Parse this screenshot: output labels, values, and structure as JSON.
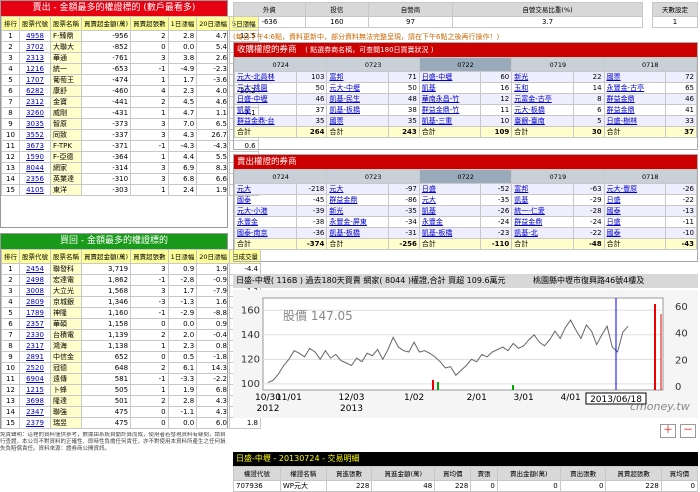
{
  "sell_panel": {
    "title": "賣出 - 金額最多的權證標的 (數戶最看多)",
    "cols": [
      "排行",
      "股票代號",
      "股票名稱",
      "買賣超金額(萬)",
      "買賣超張數",
      "1日漲幅",
      "20日漲幅",
      "5日漲幅"
    ],
    "rows": [
      [
        "1",
        "4958",
        "F-臻鼎",
        "-956",
        "2",
        "2.8",
        "4.7",
        "12.5"
      ],
      [
        "2",
        "3702",
        "大聯大",
        "-852",
        "0",
        "0.0",
        "5.4",
        "15.7"
      ],
      [
        "3",
        "2313",
        "華通",
        "-761",
        "3",
        "3.8",
        "2.6",
        "2.8"
      ],
      [
        "4",
        "1216",
        "統一",
        "-653",
        "-1",
        "-4.9",
        "-2.3",
        "0.9"
      ],
      [
        "5",
        "1707",
        "葡萄王",
        "-474",
        "1",
        "1.7",
        "-3.6",
        "6.1"
      ],
      [
        "6",
        "6282",
        "康舒",
        "-460",
        "4",
        "2.3",
        "4.0",
        "20.2"
      ],
      [
        "7",
        "2312",
        "金寶",
        "-441",
        "2",
        "4.5",
        "4.6",
        "13.3"
      ],
      [
        "8",
        "3260",
        "威剛",
        "-431",
        "1",
        "4.7",
        "1.1",
        "7.1"
      ],
      [
        "9",
        "3035",
        "智原",
        "-373",
        "3",
        "7.0",
        "6.5",
        "5.4"
      ],
      [
        "10",
        "3552",
        "同致",
        "-337",
        "3",
        "4.3",
        "26.7",
        "3.1"
      ],
      [
        "11",
        "3673",
        "F-TPK",
        "-371",
        "-1",
        "-4.3",
        "-4.3",
        "0.6"
      ],
      [
        "12",
        "1590",
        "F-亞德",
        "-364",
        "1",
        "4.4",
        "5.5",
        "5.5"
      ],
      [
        "13",
        "8044",
        "網家",
        "-314",
        "3",
        "6.9",
        "8.3",
        "3.7"
      ],
      [
        "14",
        "2356",
        "英業達",
        "-310",
        "3",
        "6.8",
        "6.6",
        "1.6"
      ],
      [
        "15",
        "4105",
        "東洋",
        "-303",
        "1",
        "2.4",
        "1.9",
        "4.1"
      ]
    ]
  },
  "buy_panel": {
    "title": "買回 - 金額最多的權證標的",
    "cols": [
      "排行",
      "股票代號",
      "股票名稱",
      "買賣超金額(萬)",
      "買賣超張數",
      "1日漲幅",
      "20日漲幅",
      "日成交量"
    ],
    "rows": [
      [
        "1",
        "2454",
        "聯發科",
        "3,719",
        "3",
        "0.9",
        "1.9",
        "-4.4"
      ],
      [
        "2",
        "2498",
        "宏達電",
        "1,862",
        "-1",
        "-2.8",
        "-0.9",
        "-3.5"
      ],
      [
        "3",
        "3008",
        "大立光",
        "1,568",
        "3",
        "1.7",
        "-7.9",
        "1.3"
      ],
      [
        "4",
        "2809",
        "京城銀",
        "1,346",
        "-3",
        "-1.3",
        "1.6",
        "-252.4"
      ],
      [
        "5",
        "1789",
        "神隆",
        "1,160",
        "-1",
        "-2.9",
        "-8.8",
        "-4.0"
      ],
      [
        "6",
        "2357",
        "華碩",
        "1,158",
        "0",
        "0.0",
        "0.9",
        "-4.4"
      ],
      [
        "7",
        "2330",
        "台積電",
        "1,139",
        "2",
        "2.0",
        "-0.4",
        "-2.3"
      ],
      [
        "8",
        "2317",
        "鴻海",
        "1,138",
        "1",
        "2.3",
        "0.8",
        "1.8"
      ],
      [
        "9",
        "2891",
        "中信金",
        "652",
        "0",
        "0.5",
        "-1.8",
        "-1.6"
      ],
      [
        "10",
        "2520",
        "冠德",
        "648",
        "2",
        "6.1",
        "14.3",
        "-5.4"
      ],
      [
        "11",
        "6904",
        "遠傳",
        "581",
        "-1",
        "-3.3",
        "-2.2",
        "-8.7"
      ],
      [
        "12",
        "1215",
        "卜蜂",
        "505",
        "1",
        "1.9",
        "6.8",
        "-1.1"
      ],
      [
        "13",
        "3698",
        "隆達",
        "501",
        "2",
        "2.8",
        "4.3",
        "-7.2"
      ],
      [
        "14",
        "2347",
        "聯強",
        "475",
        "0",
        "-1.1",
        "4.3",
        "3.1"
      ],
      [
        "15",
        "2379",
        "瑞昱",
        "475",
        "0",
        "0.0",
        "6.0",
        "1.8"
      ]
    ]
  },
  "notes": "免責聲明：這裡的資料僅供參考，數據由系統自動計算而成，使用者若發現資料有疑問，請自行查證，本公司不對資料的正確性、即時性負擔任何責任，亦不對使用本資料所產生之任何損失負賠償責任。資料來源：證券商公開資訊。",
  "summary": {
    "cols": [
      "外資",
      "投信",
      "自營商",
      "自營交易比重(%)"
    ],
    "vals": [
      "-636",
      "160",
      "97",
      "3.7"
    ],
    "days_label": "天數設定",
    "days_value": "1"
  },
  "note_line": "(每日下午4:6點，資料更新中，部分資料無法完整呈現，請在下午6點之後再行操作！)",
  "buy_brokers": {
    "title": "收購權證的券商",
    "subtitle": "( 點選券商名稱，可查閱180日買賣狀況 )",
    "dates": [
      "0724",
      "0723",
      "0722",
      "0719",
      "0718"
    ],
    "cols": [
      [
        [
          "元大-北員林",
          "103"
        ],
        [
          "元大-桃園",
          "50"
        ],
        [
          "日盛-中壢",
          "46"
        ],
        [
          "凱基",
          "37"
        ],
        [
          "群益金鼎-台",
          "35"
        ]
      ],
      [
        [
          "富邦",
          "71"
        ],
        [
          "元大-中壢",
          "50"
        ],
        [
          "凱基-民生",
          "48"
        ],
        [
          "凱基-板橋",
          "38"
        ],
        [
          "國票",
          "35"
        ]
      ],
      [
        [
          "日盛-中壢",
          "60"
        ],
        [
          "凱基",
          "16"
        ],
        [
          "華南永昌-竹",
          "12"
        ],
        [
          "群益金鼎-竹",
          "11"
        ],
        [
          "凱基-三重",
          "10"
        ]
      ],
      [
        [
          "新光",
          "22"
        ],
        [
          "玉和",
          "14"
        ],
        [
          "元富金-古亭",
          "8"
        ],
        [
          "元大-板橋",
          "6"
        ],
        [
          "臺銀-臺南",
          "5"
        ]
      ],
      [
        [
          "國票",
          "72"
        ],
        [
          "永豐金-古亭",
          "65"
        ],
        [
          "群益金鼎",
          "46"
        ],
        [
          "群益金鼎",
          "41"
        ],
        [
          "日盛-樹林",
          "33"
        ]
      ]
    ],
    "totals": [
      "264",
      "243",
      "109",
      "30",
      "37"
    ],
    "total_label": "合計"
  },
  "sell_brokers": {
    "title": "賣出權證的券商",
    "dates": [
      "0724",
      "0723",
      "0722",
      "0719",
      "0718"
    ],
    "cols": [
      [
        [
          "元大",
          "-218"
        ],
        [
          "國泰",
          "-45"
        ],
        [
          "元大-小港",
          "-39"
        ],
        [
          "永豐金",
          "-38"
        ],
        [
          "國泰-南京",
          "-36"
        ]
      ],
      [
        [
          "元大",
          "-97"
        ],
        [
          "群益金鼎",
          "-86"
        ],
        [
          "新光",
          "-35"
        ],
        [
          "永豐金-屏東",
          "-34"
        ],
        [
          "凱基-板橋",
          "-31"
        ]
      ],
      [
        [
          "日盛",
          "-52"
        ],
        [
          "元大",
          "-35"
        ],
        [
          "凱基",
          "-26"
        ],
        [
          "永豐金",
          "-24"
        ],
        [
          "凱基-板橋",
          "-23"
        ]
      ],
      [
        [
          "富邦",
          "-63"
        ],
        [
          "凱基",
          "-29"
        ],
        [
          "統一-仁愛",
          "-28"
        ],
        [
          "群益金鼎",
          "-24"
        ],
        [
          "凱基-北",
          "-22"
        ]
      ],
      [
        [
          "元大-豐原",
          "-26"
        ],
        [
          "日盛",
          "-22"
        ],
        [
          "國泰",
          "-13"
        ],
        [
          "日盛",
          "-11"
        ],
        [
          "國泰",
          "-10"
        ]
      ]
    ],
    "totals": [
      "-374",
      "-256",
      "-110",
      "-48",
      "-43"
    ],
    "total_label": "合計"
  },
  "chart_banner": "日盛-中壢( 116B ) 過去180天買賣 網家( 8044 )權證,合計 買超 109.6萬元",
  "chart_address": "桃園縣中壢市復興路46號4樓及",
  "chart_data": {
    "type": "line",
    "price_label": "股價",
    "price_value": "147.05",
    "y_ticks": [
      "160",
      "140",
      "120",
      "100"
    ],
    "ylim": [
      95,
      170
    ],
    "right_ticks": [
      "60",
      "40",
      "20",
      "0"
    ],
    "x_ticks": [
      "10/30",
      "11/01",
      "12/03",
      "1/02",
      "2/01",
      "3/01",
      "4/01",
      "5/02"
    ],
    "x_years": [
      "2012",
      "2013"
    ],
    "cursor_date": "2013/06/18",
    "series": [
      {
        "values": [
          101,
          103,
          108,
          115,
          120,
          127,
          125,
          122,
          129,
          126,
          120,
          127,
          121,
          124,
          119,
          117,
          115,
          121,
          118,
          125,
          123,
          128,
          120,
          128,
          138,
          130,
          127,
          126,
          134,
          126,
          127,
          125,
          122,
          118,
          113,
          114,
          107,
          111,
          115,
          120,
          118,
          124,
          122,
          126,
          128,
          130,
          127,
          133,
          129,
          131,
          136,
          140,
          134,
          131,
          136,
          143,
          137,
          146,
          152,
          144,
          137,
          148,
          143,
          132,
          140,
          147,
          130,
          126,
          142,
          147
        ]
      }
    ]
  },
  "zoom_in": "＋",
  "zoom_out": "－",
  "deal_title": "日盛-中壢 - 20130724 - 交易明細",
  "deal_cols": [
    "權證代號",
    "權證名稱",
    "買進張數",
    "買進金額(萬)",
    "買均價",
    "賣張",
    "賣出金額(萬)",
    "賣出張數",
    "買賣超張數",
    "買均價"
  ],
  "deal_row": [
    "707936",
    "WP元大",
    "228",
    "48",
    "228",
    "0",
    "0",
    "0",
    "228",
    "0"
  ],
  "brand": "cmoney.tw"
}
